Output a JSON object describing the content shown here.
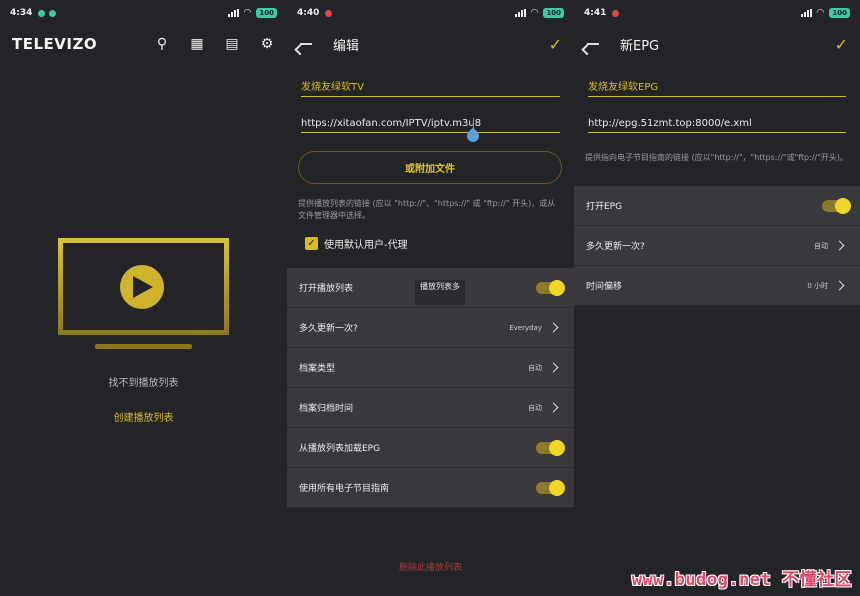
{
  "panel1": {
    "status": {
      "time": "4:34",
      "battery": "100"
    },
    "logo": "TELEVIZO",
    "empty_text": "找不到播放列表",
    "create_link": "创建播放列表"
  },
  "panel2": {
    "status": {
      "time": "4:40",
      "battery": "100"
    },
    "title": "编辑",
    "name_value": "发烧友绿软TV",
    "url_value": "https://xitaofan.com/IPTV/iptv.m3u8",
    "attach_button": "或附加文件",
    "hint": "提供播放列表的链接 (应以 \"http://\"、\"https://\" 或 \"ftp://\" 开头)，或从文件管理器中选择。",
    "user_agent_label": "使用默认用户-代理",
    "tooltip": "播放列表多",
    "rows": [
      {
        "label": "打开播放列表",
        "type": "toggle"
      },
      {
        "label": "多久更新一次?",
        "type": "value",
        "value": "Everyday"
      },
      {
        "label": "档案类型",
        "type": "value",
        "value": "自动"
      },
      {
        "label": "档案归档时间",
        "type": "value",
        "value": "自动"
      },
      {
        "label": "从播放列表加载EPG",
        "type": "toggle"
      },
      {
        "label": "使用所有电子节目指南",
        "type": "toggle"
      }
    ],
    "delete_link": "删除此播放列表"
  },
  "panel3": {
    "status": {
      "time": "4:41",
      "battery": "100"
    },
    "title": "新EPG",
    "name_value": "发烧友绿软EPG",
    "url_value": "http://epg.51zmt.top:8000/e.xml",
    "hint": "提供指向电子节目指南的链接 (应以\"http://\"，\"https://\"或\"ftp://\"开头)。",
    "rows": [
      {
        "label": "打开EPG",
        "type": "toggle"
      },
      {
        "label": "多久更新一次?",
        "type": "value",
        "value": "自动"
      },
      {
        "label": "时间偏移",
        "type": "value",
        "value": "0 小时"
      }
    ]
  },
  "watermark": "www.budog.net 不懂社区",
  "colors": {
    "accent": "#d6bd28",
    "danger": "#a23b3b",
    "row_bg": "#38393c"
  }
}
